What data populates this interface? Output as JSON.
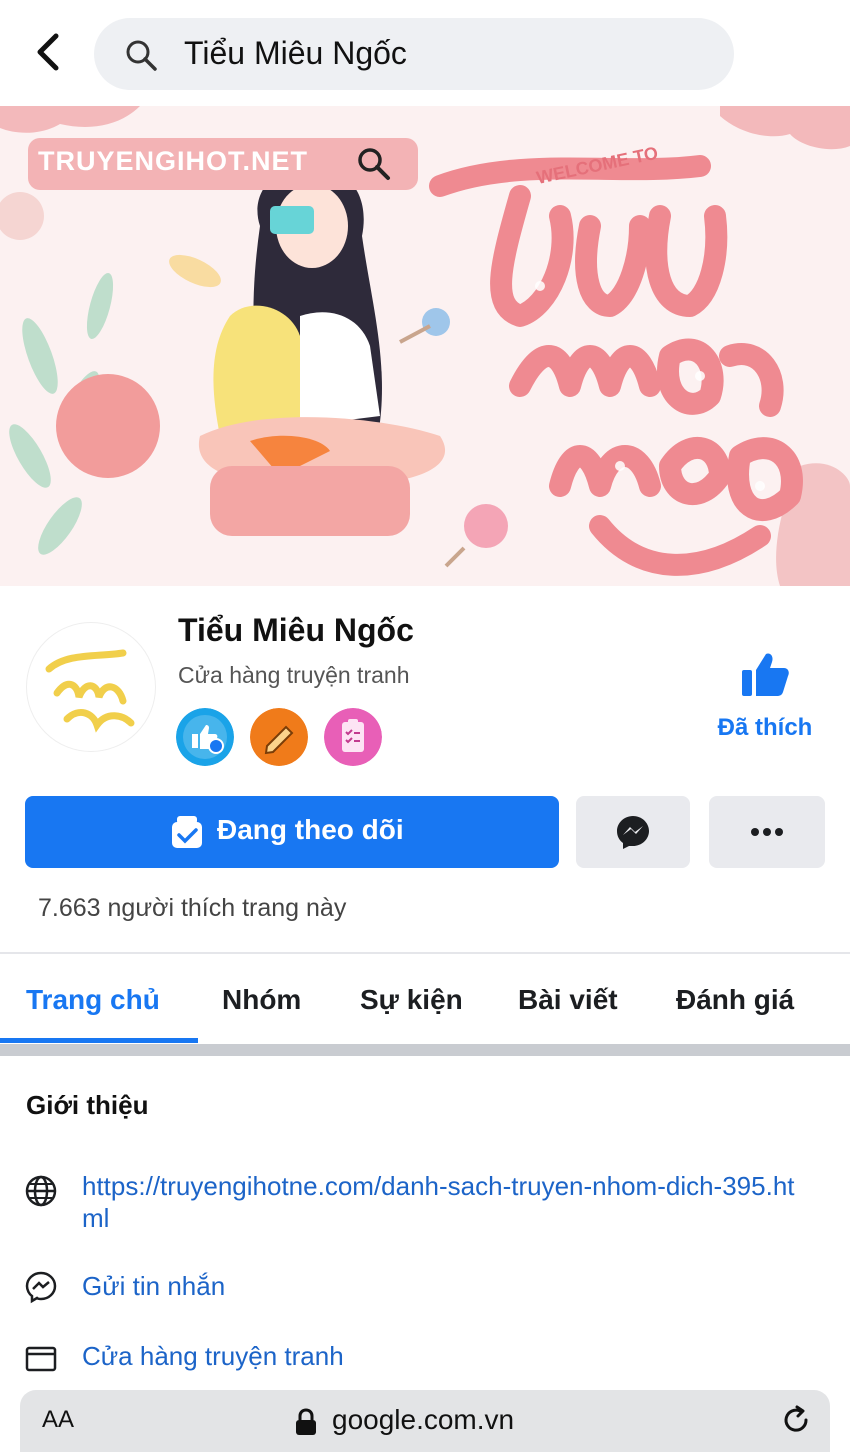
{
  "search": {
    "query": "Tiểu Miêu Ngốc"
  },
  "cover": {
    "site_text": "TRUYENGIHOT.NET",
    "welcome_text": "WELCOME TO",
    "script_lines": [
      "tiểu",
      "miêu",
      "ngốc"
    ]
  },
  "page": {
    "name": "Tiểu Miêu Ngốc",
    "category": "Cửa hàng truyện tranh",
    "avatar_lines": [
      "tiểu",
      "miêu",
      "ngốc"
    ],
    "liked_label": "Đã thích",
    "follow_label": "Đang theo dõi",
    "likes_count": "7.663 người thích trang này"
  },
  "tabs": [
    {
      "label": "Trang chủ",
      "active": true
    },
    {
      "label": "Nhóm"
    },
    {
      "label": "Sự kiện"
    },
    {
      "label": "Bài viết"
    },
    {
      "label": "Đánh giá"
    }
  ],
  "intro": {
    "title": "Giới thiệu",
    "link": "https://truyengihotne.com/danh-sach-truyen-nhom-dich-395.html",
    "message": "Gửi tin nhắn",
    "category": "Cửa hàng truyện tranh"
  },
  "browser": {
    "text_size": "AA",
    "url": "google.com.vn"
  },
  "colors": {
    "accent": "#1877f2",
    "cover_pink": "#f08a8f",
    "badge_orange": "#f07b1a",
    "badge_pink": "#e85fb7"
  }
}
